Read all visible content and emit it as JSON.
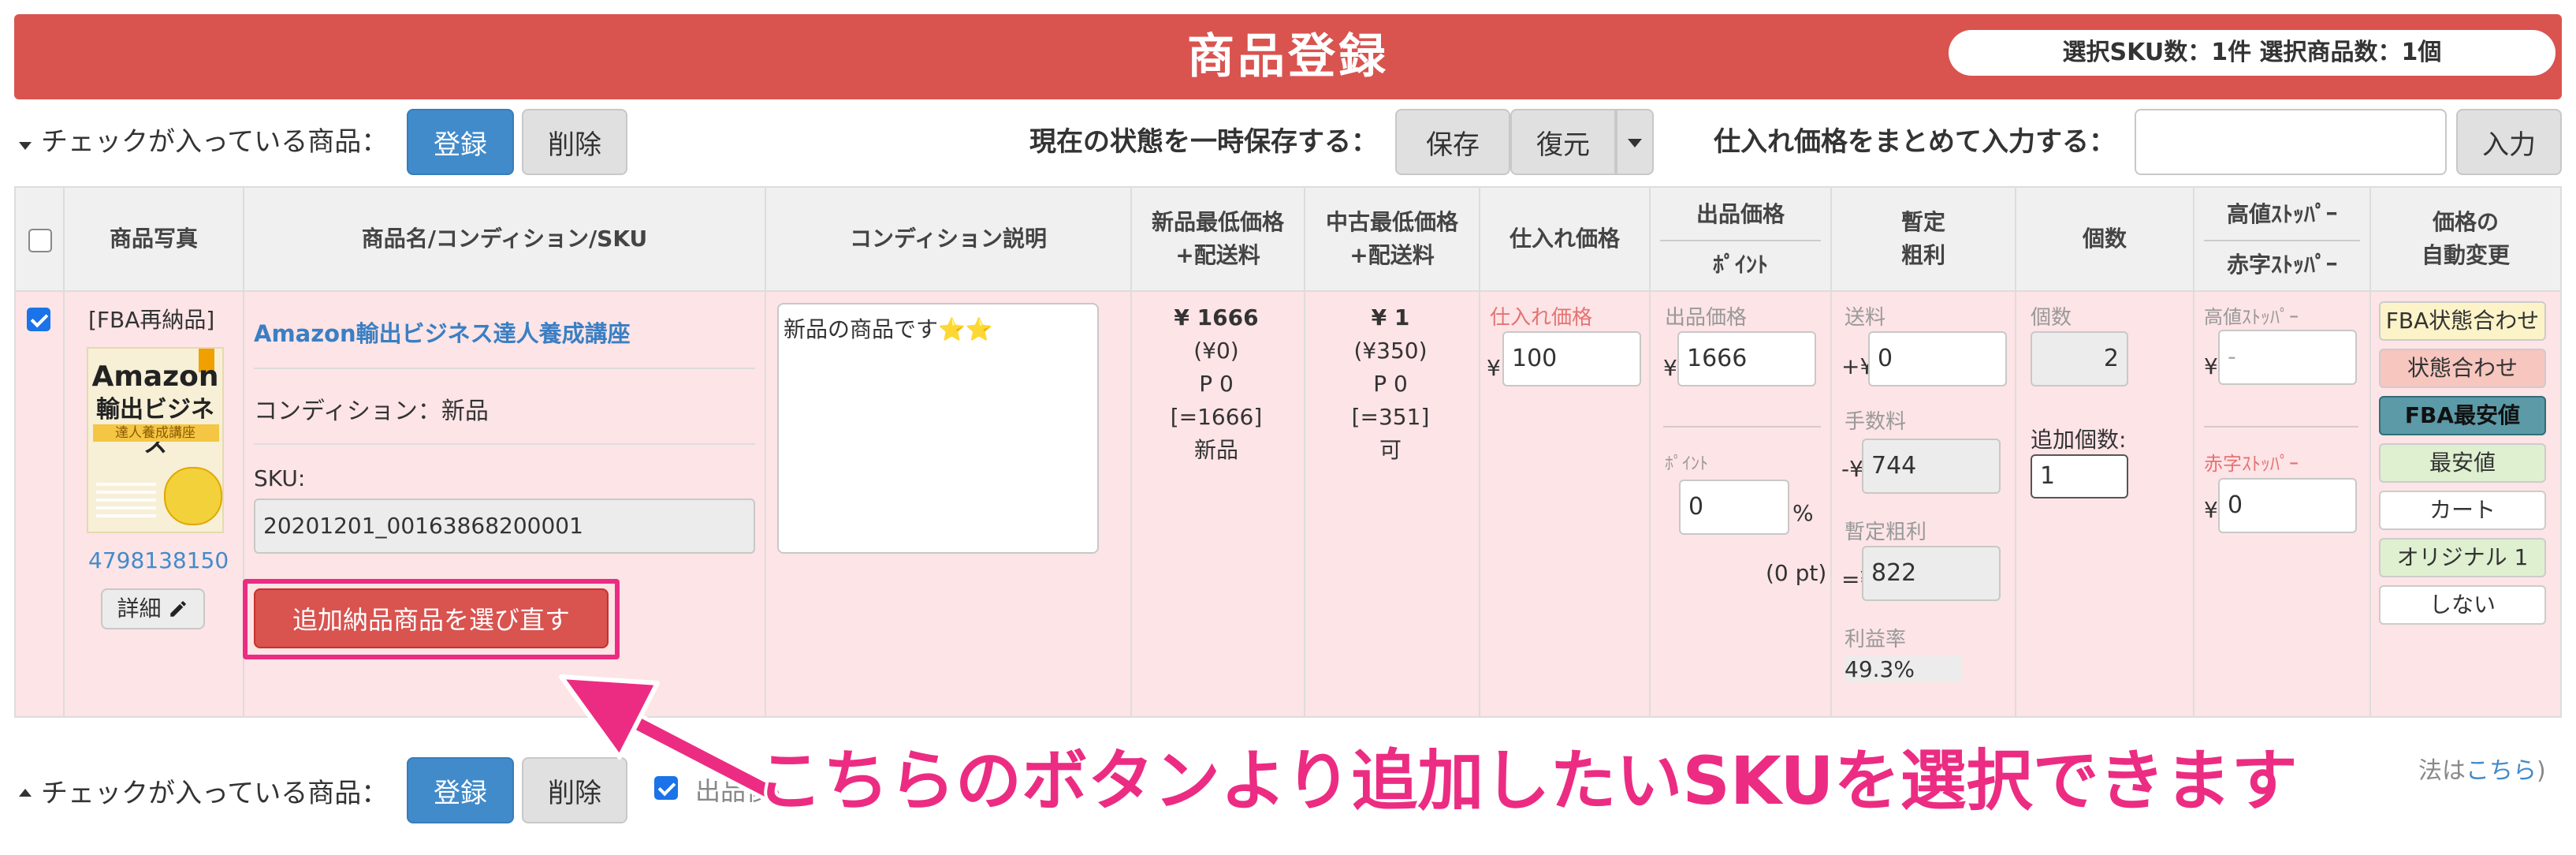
{
  "header": {
    "title": "商品登録",
    "selection_summary": "選択SKU数：1件 選択商品数：1個"
  },
  "toolbar_top": {
    "checked_label": "チェックが入っている商品：",
    "register": "登録",
    "delete": "削除",
    "save_state_label": "現在の状態を一時保存する：",
    "save": "保存",
    "restore": "復元",
    "bulk_price_label": "仕入れ価格をまとめて入力する：",
    "bulk_price_value": "",
    "enter": "入力"
  },
  "columns": {
    "photo": "商品写真",
    "name": "商品名/コンディション/SKU",
    "condition_desc": "コンディション説明",
    "new_min_1": "新品最低価格",
    "new_min_2": "+配送料",
    "used_min_1": "中古最低価格",
    "used_min_2": "+配送料",
    "purchase_price": "仕入れ価格",
    "list_price_a": "出品価格",
    "list_price_b": "ﾎﾟｲﾝﾄ",
    "profit_1": "暫定",
    "profit_2": "粗利",
    "quantity": "個数",
    "stopper_a": "高値ｽﾄｯﾊﾟｰ",
    "stopper_b": "赤字ｽﾄｯﾊﾟｰ",
    "auto_1": "価格の",
    "auto_2": "自動変更"
  },
  "row": {
    "checked": true,
    "tag": "[FBA再納品]",
    "book": {
      "title1": "Amazon",
      "title2": "輸出ビジネス",
      "subtitle": "達人養成講座"
    },
    "asin": "4798138150",
    "detail": "詳細",
    "product_name": "Amazon輸出ビジネス達人養成講座",
    "condition": "コンディション：新品",
    "sku_label": "SKU:",
    "sku_value": "20201201_00163868200001",
    "reselect_button": "追加納品商品を選び直す",
    "condition_desc": "新品の商品です⭐️⭐️",
    "new_min": {
      "price": "¥ 1666",
      "ship": "(¥0)",
      "pt": "P 0",
      "total": "[=1666]",
      "cond": "新品"
    },
    "used_min": {
      "price": "¥ 1",
      "ship": "(¥350)",
      "pt": "P 0",
      "total": "[=351]",
      "cond": "可"
    },
    "purchase": {
      "label": "仕入れ価格",
      "yen": "¥",
      "value": "100"
    },
    "listing": {
      "label": "出品価格",
      "yen": "¥",
      "value": "1666",
      "point_label": "ﾎﾟｲﾝﾄ",
      "point_value": "0",
      "percent": "%",
      "pt": "(0 pt)"
    },
    "profit": {
      "ship_label": "送料",
      "ship_prefix": "+¥",
      "ship_value": "0",
      "fee_label": "手数料",
      "fee_prefix": "-¥",
      "fee_value": "744",
      "gross_label": "暫定粗利",
      "gross_prefix": "=¥",
      "gross_value": "822",
      "rate_label": "利益率",
      "rate_value": "49.3%"
    },
    "qty": {
      "label": "個数",
      "value": "2",
      "add_label": "追加個数:",
      "add_value": "1"
    },
    "stopper": {
      "high_label": "高値ｽﾄｯﾊﾟｰ",
      "high_yen": "¥",
      "high_value": "-",
      "low_label": "赤字ｽﾄｯﾊﾟｰ",
      "low_yen": "¥",
      "low_value": "0"
    },
    "auto_options": [
      "FBA状態合わせ",
      "状態合わせ",
      "FBA最安値",
      "最安値",
      "カート",
      "オリジナル 1",
      "しない"
    ]
  },
  "toolbar_bottom": {
    "checked_label": "チェックが入っている商品：",
    "register": "登録",
    "delete": "削除",
    "partial_text": "出品後",
    "partial_tail": "法は",
    "link": "こちら",
    "close_paren": ")"
  },
  "annotation": {
    "text": "こちらのボタンより追加したいSKUを選択できます"
  },
  "colors": {
    "header_red": "#d9534f",
    "primary_blue": "#428bca",
    "row_pink": "#fde4e6",
    "annotation_pink": "#ec2c82",
    "fba_state": "#fcf3c8",
    "state": "#f6c6bf",
    "fba_lowest": "#5b9aa6",
    "lowest": "#dff0d0",
    "original": "#dff0d0"
  }
}
